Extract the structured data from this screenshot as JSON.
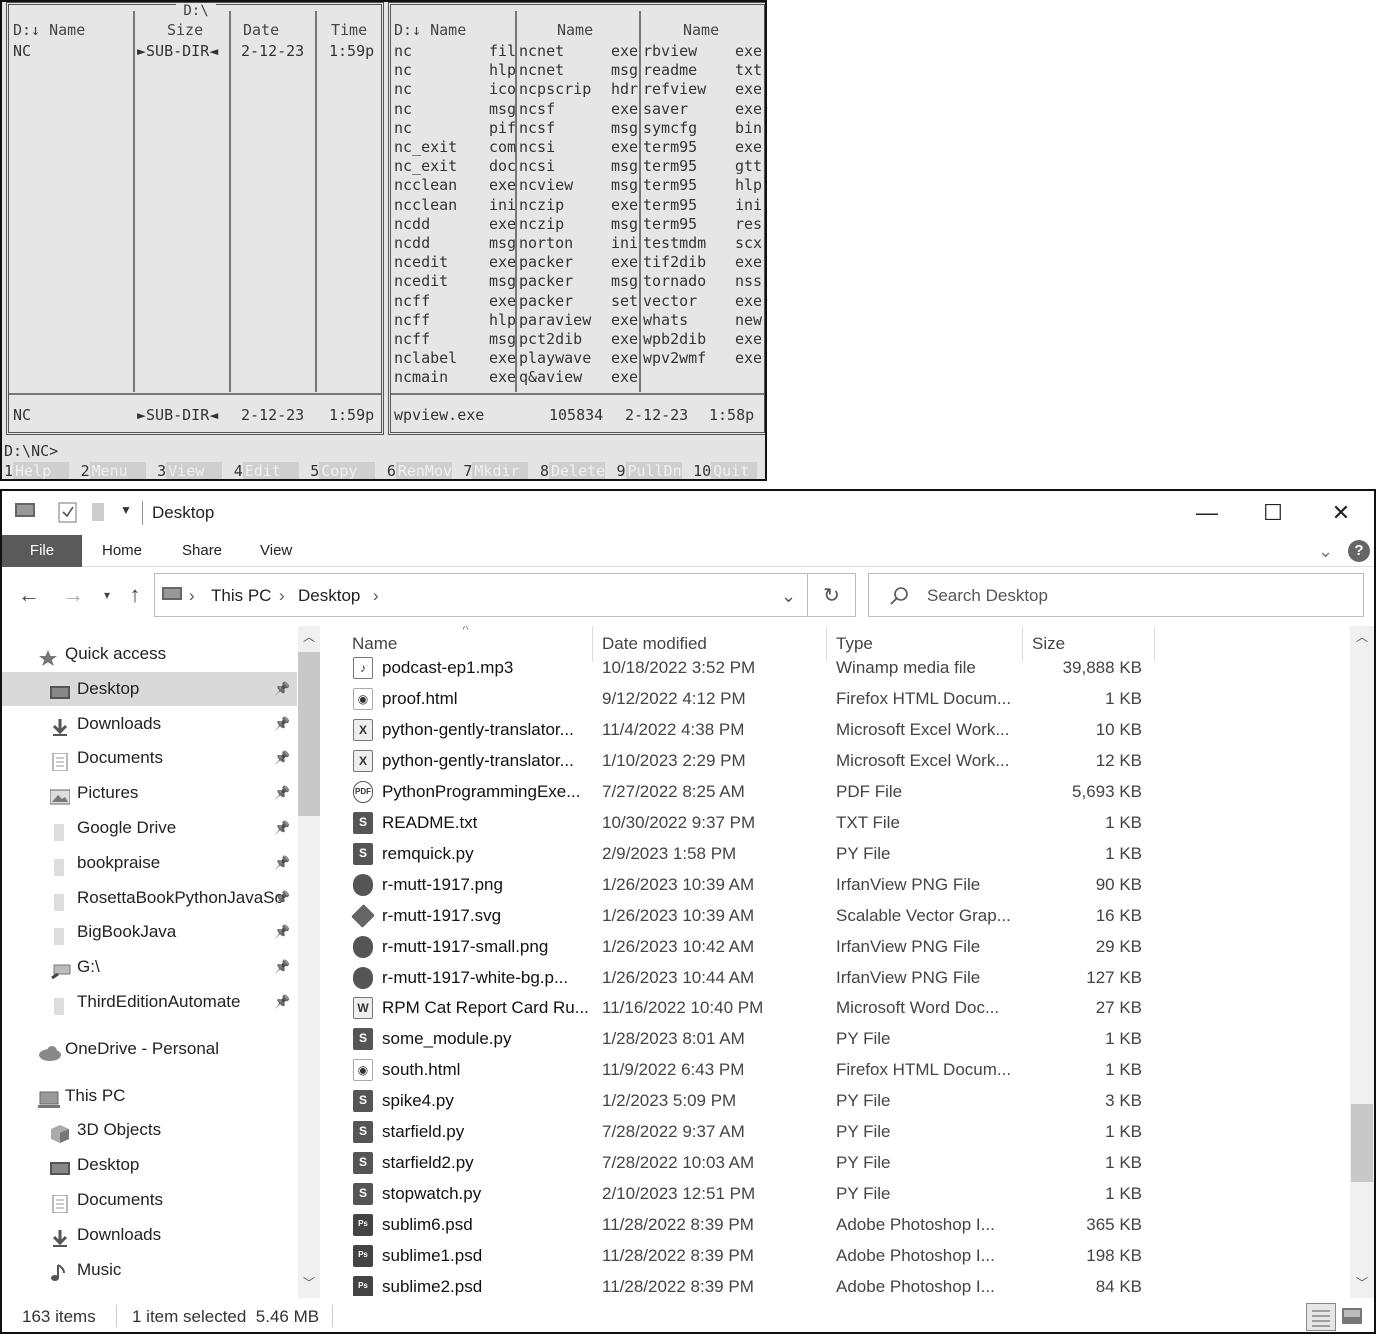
{
  "nc": {
    "drive_title": "D:\\",
    "left": {
      "headers": [
        "D:↓ Name",
        "Size",
        "Date",
        "Time"
      ],
      "row": {
        "name": "NC",
        "size": "►SUB-DIR◄",
        "date": "2-12-23",
        "time": "1:59p"
      },
      "footer": {
        "name": "NC",
        "size": "►SUB-DIR◄",
        "date": "2-12-23",
        "time": "1:59p"
      }
    },
    "right": {
      "headers": [
        "D:↓ Name",
        "Name",
        "Name"
      ],
      "col1": [
        [
          "nc",
          "fil"
        ],
        [
          "nc",
          "hlp"
        ],
        [
          "nc",
          "ico"
        ],
        [
          "nc",
          "msg"
        ],
        [
          "nc",
          "pif"
        ],
        [
          "nc_exit",
          "com"
        ],
        [
          "nc_exit",
          "doc"
        ],
        [
          "ncclean",
          "exe"
        ],
        [
          "ncclean",
          "ini"
        ],
        [
          "ncdd",
          "exe"
        ],
        [
          "ncdd",
          "msg"
        ],
        [
          "ncedit",
          "exe"
        ],
        [
          "ncedit",
          "msg"
        ],
        [
          "ncff",
          "exe"
        ],
        [
          "ncff",
          "hlp"
        ],
        [
          "ncff",
          "msg"
        ],
        [
          "nclabel",
          "exe"
        ],
        [
          "ncmain",
          "exe"
        ]
      ],
      "col2": [
        [
          "ncnet",
          "exe"
        ],
        [
          "ncnet",
          "msg"
        ],
        [
          "ncpscrip",
          "hdr"
        ],
        [
          "ncsf",
          "exe"
        ],
        [
          "ncsf",
          "msg"
        ],
        [
          "ncsi",
          "exe"
        ],
        [
          "ncsi",
          "msg"
        ],
        [
          "ncview",
          "msg"
        ],
        [
          "nczip",
          "exe"
        ],
        [
          "nczip",
          "msg"
        ],
        [
          "norton",
          "ini"
        ],
        [
          "packer",
          "exe"
        ],
        [
          "packer",
          "msg"
        ],
        [
          "packer",
          "set"
        ],
        [
          "paraview",
          "exe"
        ],
        [
          "pct2dib",
          "exe"
        ],
        [
          "playwave",
          "exe"
        ],
        [
          "q&aview",
          "exe"
        ]
      ],
      "col3": [
        [
          "rbview",
          "exe"
        ],
        [
          "readme",
          "txt"
        ],
        [
          "refview",
          "exe"
        ],
        [
          "saver",
          "exe"
        ],
        [
          "symcfg",
          "bin"
        ],
        [
          "term95",
          "exe"
        ],
        [
          "term95",
          "gtt"
        ],
        [
          "term95",
          "hlp"
        ],
        [
          "term95",
          "ini"
        ],
        [
          "term95",
          "res"
        ],
        [
          "testmdm",
          "scx"
        ],
        [
          "tif2dib",
          "exe"
        ],
        [
          "tornado",
          "nss"
        ],
        [
          "vector",
          "exe"
        ],
        [
          "whats",
          "new"
        ],
        [
          "wpb2dib",
          "exe"
        ],
        [
          "wpv2wmf",
          "exe"
        ]
      ],
      "footer": {
        "name": "wpview.exe",
        "size": "105834",
        "date": "2-12-23",
        "time": "1:58p"
      }
    },
    "prompt": "D:\\NC>",
    "keys": [
      {
        "n": "1",
        "label": "Help"
      },
      {
        "n": "2",
        "label": "Menu"
      },
      {
        "n": "3",
        "label": "View"
      },
      {
        "n": "4",
        "label": "Edit"
      },
      {
        "n": "5",
        "label": "Copy"
      },
      {
        "n": "6",
        "label": "RenMov"
      },
      {
        "n": "7",
        "label": "Mkdir"
      },
      {
        "n": "8",
        "label": "Delete"
      },
      {
        "n": "9",
        "label": "PullDn"
      },
      {
        "n": "10",
        "label": "Quit"
      }
    ]
  },
  "explorer": {
    "title": "Desktop",
    "ribbon_tabs": [
      "File",
      "Home",
      "Share",
      "View"
    ],
    "breadcrumb": [
      "This PC",
      "Desktop"
    ],
    "search_placeholder": "Search Desktop",
    "sidebar": [
      {
        "label": "Quick access",
        "icon": "star-icon",
        "indent": 0,
        "pinned": false,
        "selected": false
      },
      {
        "label": "Desktop",
        "icon": "desktop-icon",
        "indent": 1,
        "pinned": true,
        "selected": true
      },
      {
        "label": "Downloads",
        "icon": "download-icon",
        "indent": 1,
        "pinned": true,
        "selected": false
      },
      {
        "label": "Documents",
        "icon": "documents-icon",
        "indent": 1,
        "pinned": true,
        "selected": false
      },
      {
        "label": "Pictures",
        "icon": "pictures-icon",
        "indent": 1,
        "pinned": true,
        "selected": false
      },
      {
        "label": "Google Drive",
        "icon": "folder-icon",
        "indent": 1,
        "pinned": true,
        "selected": false
      },
      {
        "label": "bookpraise",
        "icon": "folder-icon",
        "indent": 1,
        "pinned": true,
        "selected": false
      },
      {
        "label": "RosettaBookPythonJavaSc",
        "icon": "folder-icon",
        "indent": 1,
        "pinned": true,
        "selected": false
      },
      {
        "label": "BigBookJava",
        "icon": "folder-icon",
        "indent": 1,
        "pinned": true,
        "selected": false
      },
      {
        "label": "G:\\",
        "icon": "network-drive-icon",
        "indent": 1,
        "pinned": true,
        "selected": false
      },
      {
        "label": "ThirdEditionAutomate",
        "icon": "folder-icon",
        "indent": 1,
        "pinned": true,
        "selected": false
      },
      {
        "label": "OneDrive - Personal",
        "icon": "cloud-icon",
        "indent": 0,
        "pinned": false,
        "selected": false,
        "gap": true
      },
      {
        "label": "This PC",
        "icon": "computer-icon",
        "indent": 0,
        "pinned": false,
        "selected": false,
        "gap": true
      },
      {
        "label": "3D Objects",
        "icon": "cube-icon",
        "indent": 1,
        "pinned": false,
        "selected": false
      },
      {
        "label": "Desktop",
        "icon": "desktop-icon",
        "indent": 1,
        "pinned": false,
        "selected": false
      },
      {
        "label": "Documents",
        "icon": "documents-icon",
        "indent": 1,
        "pinned": false,
        "selected": false
      },
      {
        "label": "Downloads",
        "icon": "download-icon",
        "indent": 1,
        "pinned": false,
        "selected": false
      },
      {
        "label": "Music",
        "icon": "music-icon",
        "indent": 1,
        "pinned": false,
        "selected": false
      }
    ],
    "columns": [
      "Name",
      "Date modified",
      "Type",
      "Size"
    ],
    "files": [
      {
        "name": "podcast-ep1.mp3",
        "date": "10/18/2022 3:52 PM",
        "type": "Winamp media file",
        "size": "39,888 KB",
        "icon": "audio-file-icon"
      },
      {
        "name": "proof.html",
        "date": "9/12/2022 4:12 PM",
        "type": "Firefox HTML Docum...",
        "size": "1 KB",
        "icon": "html-file-icon"
      },
      {
        "name": "python-gently-translator...",
        "date": "11/4/2022 4:38 PM",
        "type": "Microsoft Excel Work...",
        "size": "10 KB",
        "icon": "excel-file-icon"
      },
      {
        "name": "python-gently-translator...",
        "date": "1/10/2023 2:29 PM",
        "type": "Microsoft Excel Work...",
        "size": "12 KB",
        "icon": "excel-file-icon"
      },
      {
        "name": "PythonProgrammingExe...",
        "date": "7/27/2022 8:25 AM",
        "type": "PDF File",
        "size": "5,693 KB",
        "icon": "pdf-file-icon"
      },
      {
        "name": "README.txt",
        "date": "10/30/2022 9:37 PM",
        "type": "TXT File",
        "size": "1 KB",
        "icon": "sublime-file-icon"
      },
      {
        "name": "remquick.py",
        "date": "2/9/2023 1:58 PM",
        "type": "PY File",
        "size": "1 KB",
        "icon": "sublime-file-icon"
      },
      {
        "name": "r-mutt-1917.png",
        "date": "1/26/2023 10:39 AM",
        "type": "IrfanView PNG File",
        "size": "90 KB",
        "icon": "irfanview-file-icon"
      },
      {
        "name": "r-mutt-1917.svg",
        "date": "1/26/2023 10:39 AM",
        "type": "Scalable Vector Grap...",
        "size": "16 KB",
        "icon": "svg-file-icon"
      },
      {
        "name": "r-mutt-1917-small.png",
        "date": "1/26/2023 10:42 AM",
        "type": "IrfanView PNG File",
        "size": "29 KB",
        "icon": "irfanview-file-icon"
      },
      {
        "name": "r-mutt-1917-white-bg.p...",
        "date": "1/26/2023 10:44 AM",
        "type": "IrfanView PNG File",
        "size": "127 KB",
        "icon": "irfanview-file-icon"
      },
      {
        "name": "RPM Cat Report Card Ru...",
        "date": "11/16/2022 10:40 PM",
        "type": "Microsoft Word Doc...",
        "size": "27 KB",
        "icon": "word-file-icon"
      },
      {
        "name": "some_module.py",
        "date": "1/28/2023 8:01 AM",
        "type": "PY File",
        "size": "1 KB",
        "icon": "sublime-file-icon"
      },
      {
        "name": "south.html",
        "date": "11/9/2022 6:43 PM",
        "type": "Firefox HTML Docum...",
        "size": "1 KB",
        "icon": "html-file-icon"
      },
      {
        "name": "spike4.py",
        "date": "1/2/2023 5:09 PM",
        "type": "PY File",
        "size": "3 KB",
        "icon": "sublime-file-icon"
      },
      {
        "name": "starfield.py",
        "date": "7/28/2022 9:37 AM",
        "type": "PY File",
        "size": "1 KB",
        "icon": "sublime-file-icon"
      },
      {
        "name": "starfield2.py",
        "date": "7/28/2022 10:03 AM",
        "type": "PY File",
        "size": "1 KB",
        "icon": "sublime-file-icon"
      },
      {
        "name": "stopwatch.py",
        "date": "2/10/2023 12:51 PM",
        "type": "PY File",
        "size": "1 KB",
        "icon": "sublime-file-icon"
      },
      {
        "name": "sublim6.psd",
        "date": "11/28/2022 8:39 PM",
        "type": "Adobe Photoshop I...",
        "size": "365 KB",
        "icon": "psd-file-icon"
      },
      {
        "name": "sublime1.psd",
        "date": "11/28/2022 8:39 PM",
        "type": "Adobe Photoshop I...",
        "size": "198 KB",
        "icon": "psd-file-icon"
      },
      {
        "name": "sublime2.psd",
        "date": "11/28/2022 8:39 PM",
        "type": "Adobe Photoshop I...",
        "size": "84 KB",
        "icon": "psd-file-icon"
      }
    ],
    "status": {
      "count": "163 items",
      "selection": "1 item selected  5.46 MB"
    }
  }
}
